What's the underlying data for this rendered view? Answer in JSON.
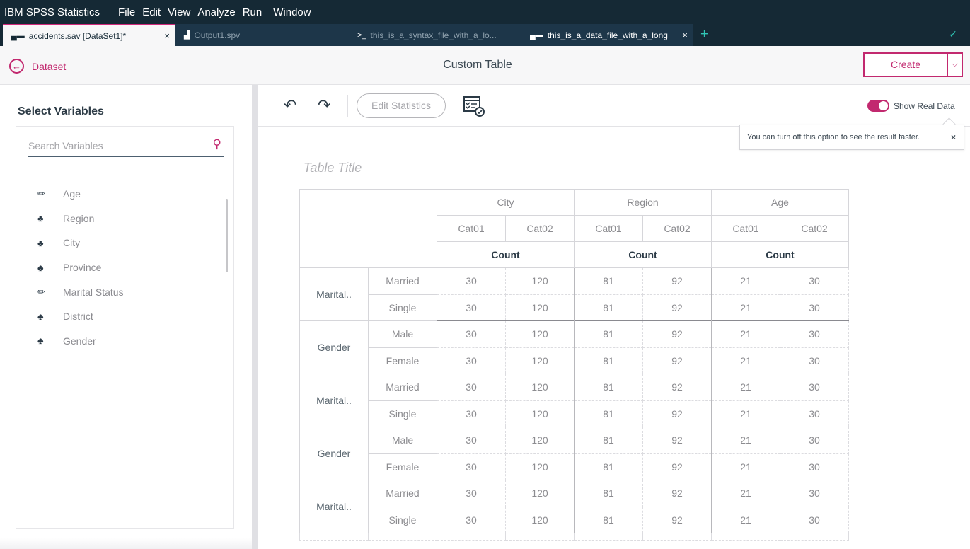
{
  "menubar": {
    "app_name": "IBM SPSS Statistics",
    "items": [
      "File",
      "Edit",
      "View",
      "Analyze",
      "Run",
      "Window"
    ]
  },
  "tabs": [
    {
      "label": "accidents.sav [DataSet1]*",
      "icon": "data-file-icon",
      "active": true,
      "closable": true
    },
    {
      "label": "Output1.spv",
      "icon": "output-chart-icon",
      "active": false,
      "closable": false
    },
    {
      "label": "this_is_a_syntax_file_with_a_lo...",
      "icon": "syntax-terminal-icon",
      "active": false,
      "closable": false
    },
    {
      "label": "this_is_a_data_file_with_a_long",
      "icon": "data-file-icon",
      "active": false,
      "closable": true
    }
  ],
  "tabbar": {
    "add_icon": "plus-icon",
    "overflow_icon": "chevron-down-icon",
    "close_glyph": "×"
  },
  "header": {
    "back_label": "Dataset",
    "title": "Custom Table",
    "create_label": "Create"
  },
  "sidebar": {
    "title": "Select Variables",
    "search_placeholder": "Search Variables",
    "variables": [
      {
        "name": "Age",
        "type": "scale"
      },
      {
        "name": "Region",
        "type": "nominal"
      },
      {
        "name": "City",
        "type": "nominal"
      },
      {
        "name": "Province",
        "type": "nominal"
      },
      {
        "name": "Marital Status",
        "type": "scale"
      },
      {
        "name": "District",
        "type": "nominal"
      },
      {
        "name": "Gender",
        "type": "nominal"
      }
    ]
  },
  "toolbar": {
    "edit_statistics_label": "Edit Statistics",
    "show_real_data_label": "Show Real Data",
    "show_real_data_on": true,
    "tooltip_text": "You can turn off this option to see the result faster.",
    "tooltip_close": "×"
  },
  "table": {
    "title_placeholder": "Table Title",
    "column_groups": [
      {
        "label": "City",
        "categories": [
          "Cat01",
          "Cat02"
        ],
        "statistic": "Count"
      },
      {
        "label": "Region",
        "categories": [
          "Cat01",
          "Cat02"
        ],
        "statistic": "Count"
      },
      {
        "label": "Age",
        "categories": [
          "Cat01",
          "Cat02"
        ],
        "statistic": "Count"
      }
    ],
    "row_groups": [
      {
        "label": "Marital..",
        "rows": [
          {
            "label": "Married",
            "values": [
              30,
              120,
              81,
              92,
              21,
              30
            ]
          },
          {
            "label": "Single",
            "values": [
              30,
              120,
              81,
              92,
              21,
              30
            ]
          }
        ]
      },
      {
        "label": "Gender",
        "rows": [
          {
            "label": "Male",
            "values": [
              30,
              120,
              81,
              92,
              21,
              30
            ]
          },
          {
            "label": "Female",
            "values": [
              30,
              120,
              81,
              92,
              21,
              30
            ]
          }
        ]
      },
      {
        "label": "Marital..",
        "rows": [
          {
            "label": "Married",
            "values": [
              30,
              120,
              81,
              92,
              21,
              30
            ]
          },
          {
            "label": "Single",
            "values": [
              30,
              120,
              81,
              92,
              21,
              30
            ]
          }
        ]
      },
      {
        "label": "Gender",
        "rows": [
          {
            "label": "Male",
            "values": [
              30,
              120,
              81,
              92,
              21,
              30
            ]
          },
          {
            "label": "Female",
            "values": [
              30,
              120,
              81,
              92,
              21,
              30
            ]
          }
        ]
      },
      {
        "label": "Marital..",
        "rows": [
          {
            "label": "Married",
            "values": [
              30,
              120,
              81,
              92,
              21,
              30
            ]
          },
          {
            "label": "Single",
            "values": [
              30,
              120,
              81,
              92,
              21,
              30
            ]
          }
        ]
      }
    ]
  },
  "colors": {
    "accent": "#c2296f",
    "menubar_bg": "#152935",
    "teal": "#30c5b5"
  }
}
